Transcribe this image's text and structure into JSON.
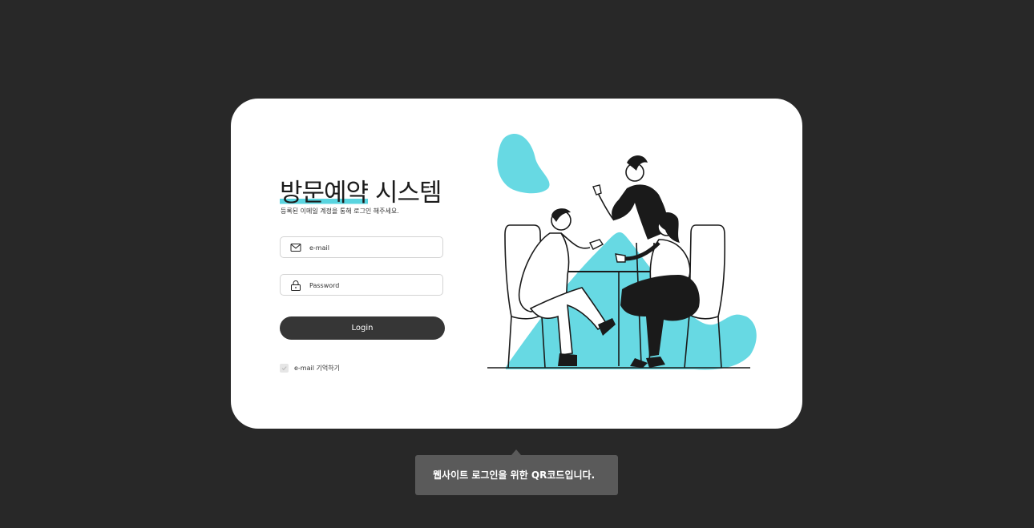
{
  "login": {
    "title_highlight": "방문예약",
    "title_rest": " 시스템",
    "subtitle": "등록된 이메일 계정을 통해 로그인 해주세요.",
    "email": {
      "placeholder": "e-mail",
      "value": "",
      "icon": "mail-icon"
    },
    "password": {
      "placeholder": "Password",
      "value": "",
      "icon": "lock-icon"
    },
    "button_label": "Login",
    "remember_label": "e-mail 기억하기",
    "remember_checked": true
  },
  "tooltip": {
    "text": "웹사이트 로그인을 위한 QR코드입니다."
  },
  "colors": {
    "accent": "#59d4df",
    "background": "#282828",
    "card": "#ffffff",
    "button": "#363636",
    "tooltip": "#5a5a5a"
  }
}
